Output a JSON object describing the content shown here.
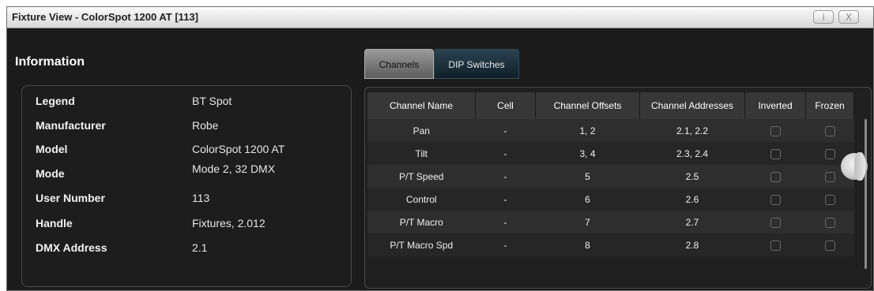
{
  "window": {
    "title": "Fixture View - ColorSpot 1200 AT [113]",
    "info_button": "i",
    "close_button": "X"
  },
  "information": {
    "heading": "Information",
    "rows": [
      {
        "label": "Legend",
        "value": "BT Spot"
      },
      {
        "label": "Manufacturer",
        "value": "Robe"
      },
      {
        "label": "Model",
        "value": "ColorSpot 1200 AT"
      },
      {
        "label": "Mode",
        "value": "Mode 2, 32 DMX"
      },
      {
        "label": "User Number",
        "value": "113"
      },
      {
        "label": "Handle",
        "value": "Fixtures, 2.012"
      },
      {
        "label": "DMX Address",
        "value": "2.1"
      }
    ]
  },
  "tabs": [
    {
      "label": "Channels",
      "active": true
    },
    {
      "label": "DIP Switches",
      "active": false
    }
  ],
  "channels_table": {
    "headers": [
      "Channel Name",
      "Cell",
      "Channel Offsets",
      "Channel Addresses",
      "Inverted",
      "Frozen"
    ],
    "rows": [
      {
        "name": "Pan",
        "cell": "-",
        "offsets": "1, 2",
        "addresses": "2.1, 2.2",
        "inverted": false,
        "frozen": false
      },
      {
        "name": "Tilt",
        "cell": "-",
        "offsets": "3, 4",
        "addresses": "2.3, 2.4",
        "inverted": false,
        "frozen": false
      },
      {
        "name": "P/T Speed",
        "cell": "-",
        "offsets": "5",
        "addresses": "2.5",
        "inverted": false,
        "frozen": false
      },
      {
        "name": "Control",
        "cell": "-",
        "offsets": "6",
        "addresses": "2.6",
        "inverted": false,
        "frozen": false
      },
      {
        "name": "P/T Macro",
        "cell": "-",
        "offsets": "7",
        "addresses": "2.7",
        "inverted": false,
        "frozen": false
      },
      {
        "name": "P/T Macro Spd",
        "cell": "-",
        "offsets": "8",
        "addresses": "2.8",
        "inverted": false,
        "frozen": false
      }
    ]
  },
  "colors": {
    "window_bg": "#1b1b1b",
    "titlebar_bg": "#e6e6e6",
    "active_tab": "#7a7a7a",
    "inactive_tab": "#1c2f3b",
    "header_bg": "#373737"
  }
}
